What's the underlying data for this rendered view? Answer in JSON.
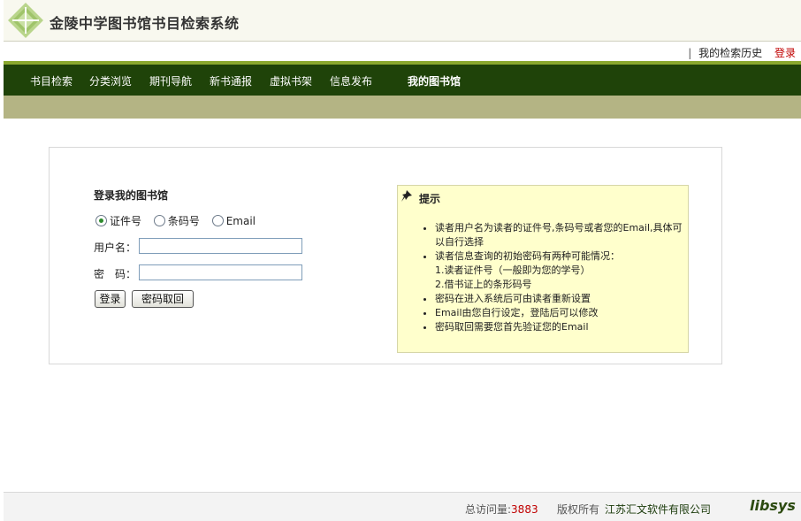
{
  "header": {
    "site_title": "金陵中学图书馆书目检索系统",
    "links": {
      "separator": "|",
      "history": "我的检索历史",
      "login": "登录"
    }
  },
  "nav": {
    "items": [
      {
        "label": "书目检索"
      },
      {
        "label": "分类浏览"
      },
      {
        "label": "期刊导航"
      },
      {
        "label": "新书通报"
      },
      {
        "label": "虚拟书架"
      },
      {
        "label": "信息发布"
      },
      {
        "label": "我的图书馆",
        "active": true
      }
    ]
  },
  "login": {
    "title": "登录我的图书馆",
    "options": [
      {
        "label": "证件号",
        "checked": true
      },
      {
        "label": "条码号",
        "checked": false
      },
      {
        "label": "Email",
        "checked": false
      }
    ],
    "username_label": "用户名：",
    "password_label": "密　码：",
    "username_value": "",
    "password_value": "",
    "login_button": "登录",
    "retrieve_button": "密码取回"
  },
  "tips": {
    "title": "提示",
    "items": [
      "读者用户名为读者的证件号,条码号或者您的Email,具体可以自行选择",
      "读者信息查询的初始密码有两种可能情况：",
      "密码在进入系统后可由读者重新设置",
      "Email由您自行设定，登陆后可以修改",
      "密码取回需要您首先验证您的Email"
    ],
    "sub_items": [
      "1.读者证件号（一般即为您的学号）",
      "2.借书证上的条形码号"
    ]
  },
  "footer": {
    "visits_label": "总访问量:",
    "visits_count": "3883",
    "copyright_label": "版权所有",
    "company": "江苏汇文软件有限公司",
    "brand": "libsys"
  },
  "colors": {
    "nav_bg": "#1f4309",
    "nav_stripe": "#8aa82e",
    "subbar": "#b4b484",
    "tips_bg": "#ffffcc",
    "accent_red": "#c00000"
  }
}
